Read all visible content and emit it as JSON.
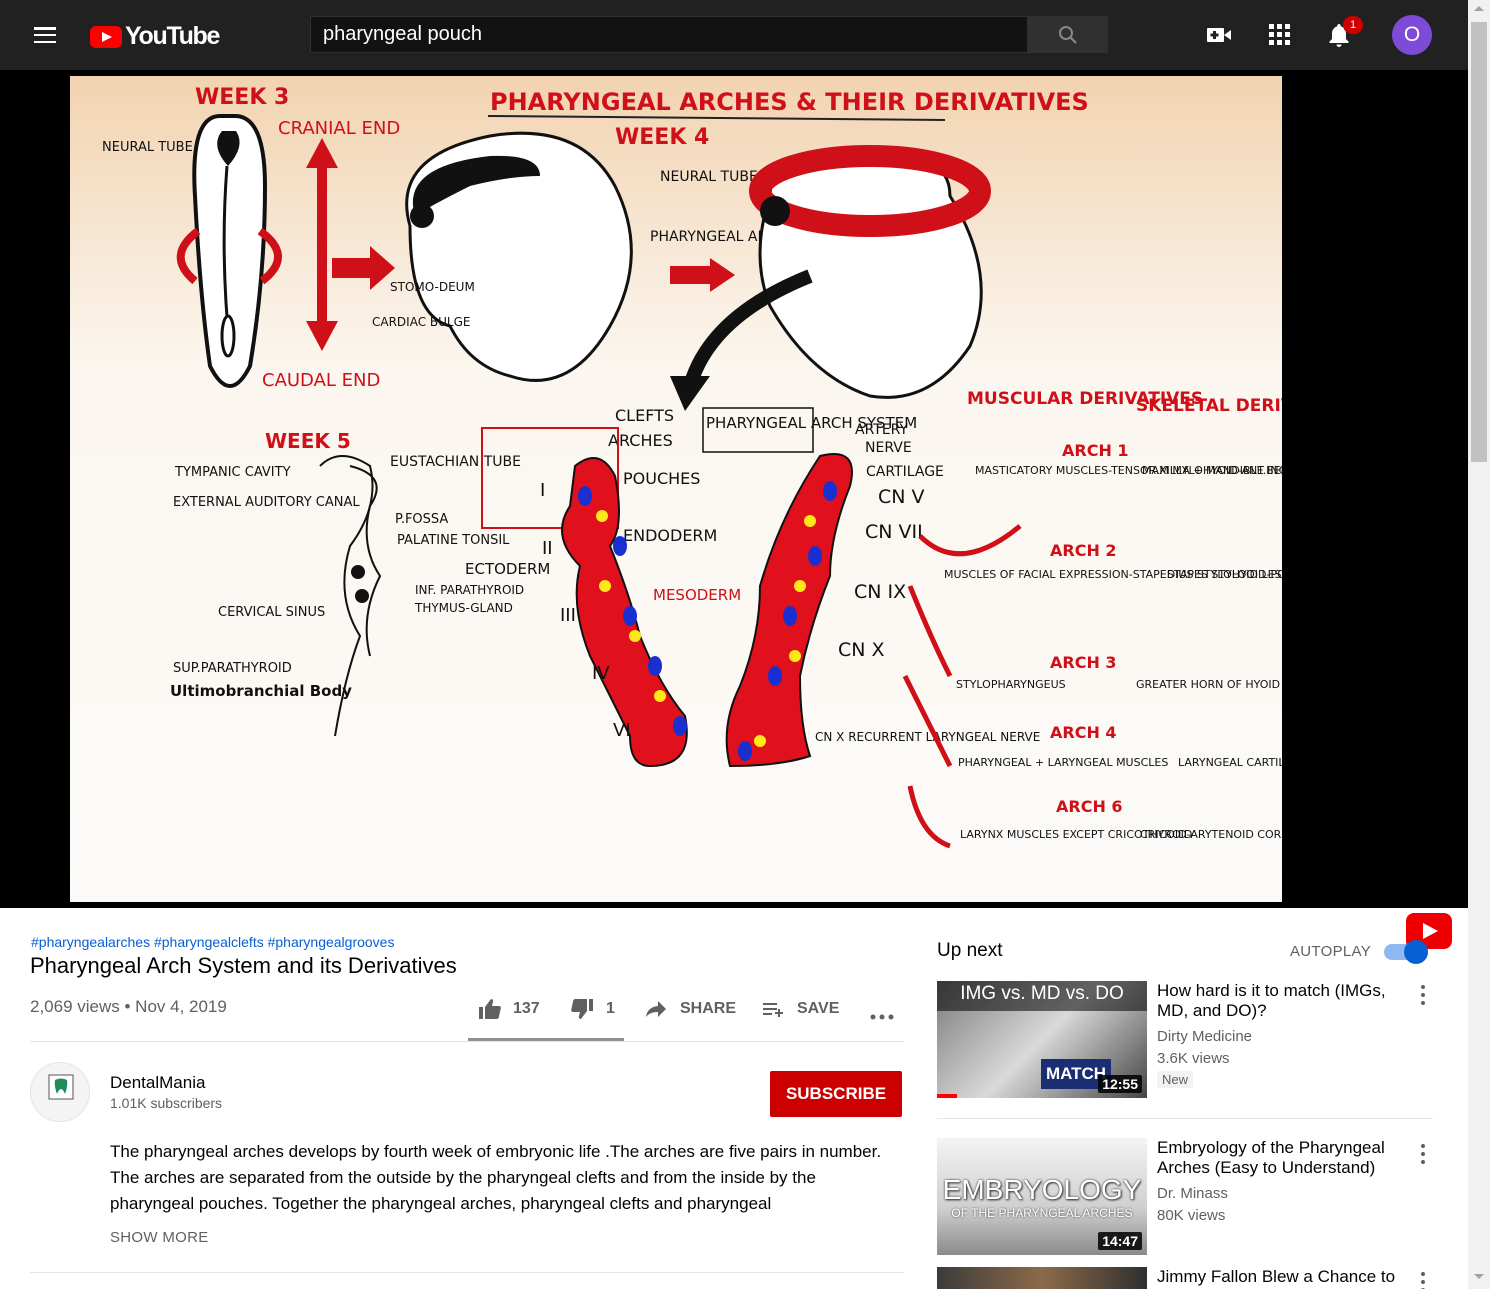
{
  "masthead": {
    "logo_text": "YouTube",
    "search_value": "pharyngeal pouch",
    "notification_count": "1",
    "avatar_letter": "O"
  },
  "video_frame": {
    "title": "PHARYNGEAL ARCHES & THEIR DERIVATIVES",
    "week3": "WEEK 3",
    "week4": "WEEK 4",
    "week5": "WEEK 5",
    "cranial_end": "CRANIAL END",
    "caudal_end": "CAUDAL END",
    "neural_tube_left": "NEURAL TUBE",
    "neural_tube_mid": "NEURAL TUBE",
    "pharyngeal_arches_mid": "PHARYNGEAL ARCHES",
    "stomodeum": "STOMO-DEUM",
    "cardiac_bulge": "CARDIAC BULGE",
    "clefts": "CLEFTS",
    "arches": "ARCHES",
    "pouches": "POUCHES",
    "arch_system": "PHARYNGEAL ARCH SYSTEM",
    "endoderm": "ENDODERM",
    "ectoderm": "ECTODERM",
    "mesoderm": "MESODERM",
    "artery": "ARTERY",
    "nerve": "NERVE",
    "cartilage": "CARTILAGE",
    "eustachian": "EUSTACHIAN TUBE",
    "tympanic": "TYMPANIC CAVITY",
    "external_auditory": "EXTERNAL AUDITORY CANAL",
    "p_fossa": "P.FOSSA",
    "palatine": "PALATINE TONSIL",
    "inf_parathyroid": "INF. PARATHYROID",
    "thymus": "THYMUS-GLAND",
    "cervical": "CERVICAL SINUS",
    "sup_parathyroid": "SUP.PARATHYROID",
    "ultimobranchial": "Ultimobranchial Body",
    "cn5": "CN V",
    "cn7": "CN VII",
    "cn9": "CN IX",
    "cn10": "CN X",
    "cn10b": "CN X RECURRENT LARYNGEAL NERVE",
    "muscular": "MUSCULAR DERIVATIVES",
    "skeletal": "SKELETAL DERIVATIVES",
    "arch1": "ARCH 1",
    "arch2": "ARCH 2",
    "arch3": "ARCH 3",
    "arch4": "ARCH 4",
    "arch6": "ARCH 6",
    "m1": "MASTICATORY MUSCLES-TENSOR.M MYLOHYOID-ANT.BELLY OF DIGASTRIC",
    "s1": "MAXILLA + MANDIBLE INCUS & MALLEUS",
    "m2": "MUSCLES OF FACIAL EXPRESSION-STAPEDIUS STYLOHYOID-POSTERIOR BELLY OF DIGASTRIC",
    "s2": "STAPES STYLOID LESSER HORN OF HYOID",
    "m3": "STYLOPHARYNGEUS",
    "s3": "GREATER HORN OF HYOID - BODY",
    "m4": "PHARYNGEAL + LARYNGEAL MUSCLES",
    "s4": "LARYNGEAL CARTILAGES",
    "m6": "LARYNX MUSCLES EXCEPT CRICOTHYROID",
    "s6": "CRICOID-ARYTENOID CORNICULATE-C"
  },
  "video": {
    "hashtags": "#pharyngealarches #pharyngealclefts #pharyngealgrooves",
    "title": "Pharyngeal Arch System and its Derivatives",
    "views_date": "2,069 views • Nov 4, 2019",
    "likes": "137",
    "dislikes": "1",
    "share_label": "SHARE",
    "save_label": "SAVE"
  },
  "channel": {
    "name": "DentalMania",
    "subscribers": "1.01K subscribers",
    "subscribe_label": "SUBSCRIBE"
  },
  "description": {
    "text": "The pharyngeal arches develops by fourth week of embryonic life .The arches are five pairs in number. The arches are separated from the outside by the pharyngeal clefts and from the inside by the pharyngeal pouches. Together the pharyngeal arches, pharyngeal clefts and pharyngeal",
    "show_more": "SHOW MORE"
  },
  "sidebar": {
    "up_next": "Up next",
    "autoplay": "AUTOPLAY",
    "autoplay_on": true,
    "items": [
      {
        "title": "How hard is it to match (IMGs, MD, and DO)?",
        "channel": "Dirty Medicine",
        "views": "3.6K views",
        "badge": "New",
        "duration": "12:55",
        "thumb_text_top": "IMG vs. MD vs. DO",
        "thumb_text_bottom": "MATCH"
      },
      {
        "title": "Embryology of the Pharyngeal Arches (Easy to Understand)",
        "channel": "Dr. Minass",
        "views": "80K views",
        "duration": "14:47",
        "thumb_text_top": "EMBRYOLOGY",
        "thumb_text_bottom": "OF THE PHARYNGEAL ARCHES"
      },
      {
        "title": "Jimmy Fallon Blew a Chance to"
      }
    ]
  }
}
